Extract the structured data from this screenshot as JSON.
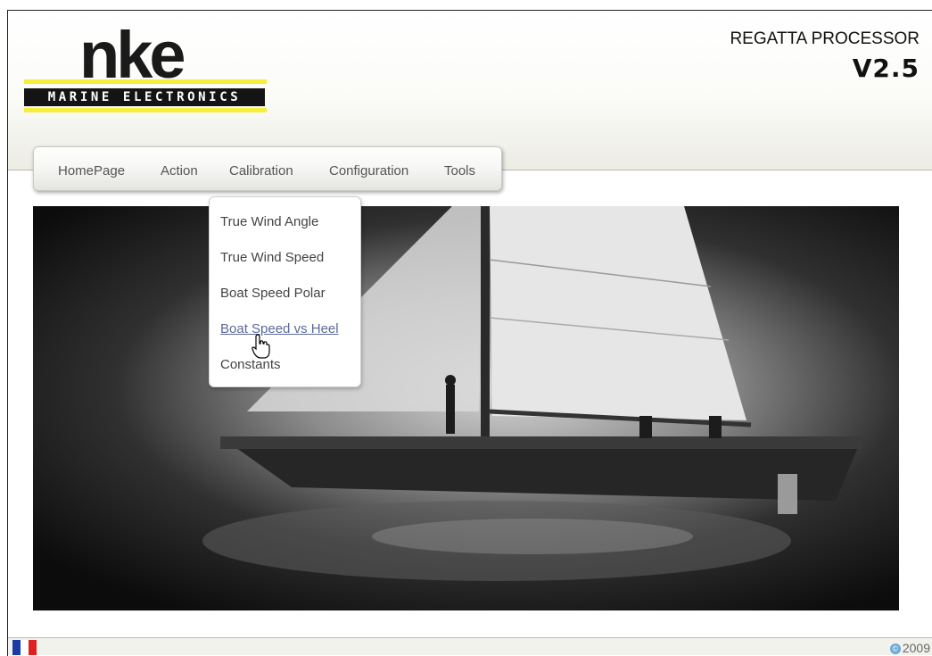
{
  "logo": {
    "word": "nke",
    "tagline": "MARINE ELECTRONICS"
  },
  "product": {
    "name": "REGATTA PROCESSOR",
    "version": "V2.5"
  },
  "nav": {
    "items": [
      "HomePage",
      "Action",
      "Calibration",
      "Configuration",
      "Tools"
    ]
  },
  "dropdown": {
    "parent": "Calibration",
    "items": [
      "True Wind Angle",
      "True Wind Speed",
      "Boat Speed Polar",
      "Boat Speed vs Heel",
      "Constants"
    ],
    "hovered": "Boat Speed vs Heel"
  },
  "footer": {
    "language_flag": "flag-france-icon",
    "copyright": "2009"
  },
  "colors": {
    "logo_yellow": "#f5ee3a",
    "hover_link": "#5a6a9a",
    "flag_blue": "#1a3aa8",
    "flag_red": "#e02020"
  }
}
